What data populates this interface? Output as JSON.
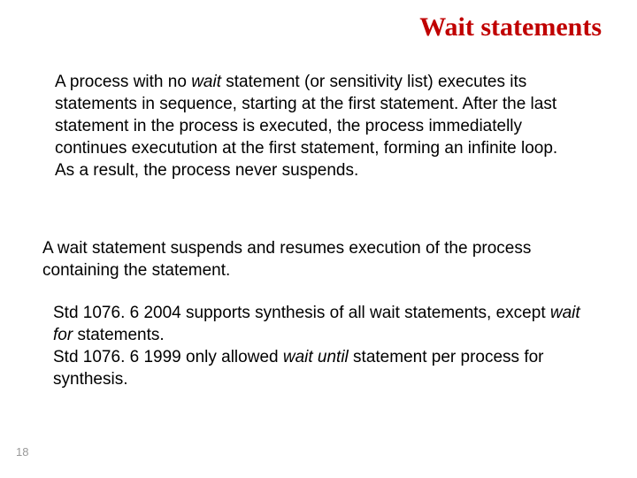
{
  "title": "Wait statements",
  "p1": {
    "t1": "A process with no ",
    "em1": "wait",
    "t2": " statement (or sensitivity list) executes its statements in sequence, starting at the first statement. After the last statement in the process is executed, the process immediatelly continues executution at the first statement, forming an infinite loop. As a result, the process never suspends."
  },
  "p2": "A wait statement suspends and resumes execution of the process containing the statement.",
  "p3": {
    "t1": "Std 1076. 6 2004 supports synthesis of all wait statements, except ",
    "em1": "wait for",
    "t2": " statements.",
    "t3": "Std 1076. 6 1999 only allowed ",
    "em2": "wait until",
    "t4": " statement per process for synthesis."
  },
  "pagenum": "18"
}
